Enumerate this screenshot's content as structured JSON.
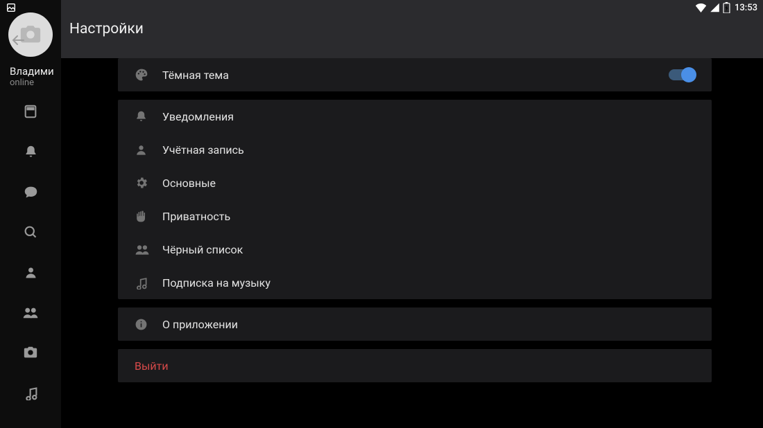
{
  "status": {
    "time": "13:53"
  },
  "header": {
    "title": "Настройки"
  },
  "user": {
    "name": "Владими",
    "status": "online"
  },
  "settings": {
    "dark_theme": {
      "label": "Тёмная тема",
      "enabled": true
    },
    "items": [
      {
        "key": "notifications",
        "label": "Уведомления"
      },
      {
        "key": "account",
        "label": "Учётная запись"
      },
      {
        "key": "general",
        "label": "Основные"
      },
      {
        "key": "privacy",
        "label": "Приватность"
      },
      {
        "key": "blacklist",
        "label": "Чёрный список"
      },
      {
        "key": "music_sub",
        "label": "Подписка на музыку"
      }
    ],
    "about": {
      "label": "О приложении"
    },
    "logout": {
      "label": "Выйти"
    }
  }
}
